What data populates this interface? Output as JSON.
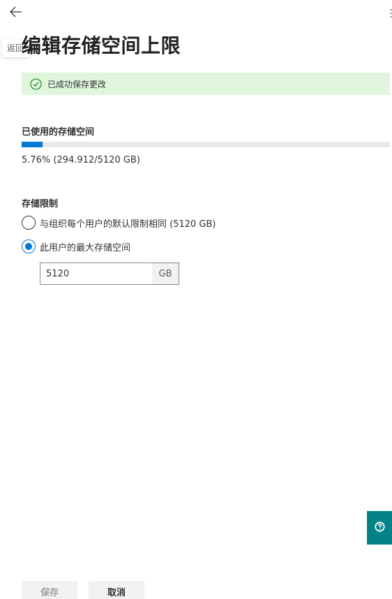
{
  "nav": {
    "back_tooltip": "返回"
  },
  "header": {
    "title": "编辑存储空间上限"
  },
  "notification": {
    "message": "已成功保存更改"
  },
  "usage": {
    "label": "已使用的存储空间",
    "percent": 5.76,
    "text": "5.76% (294.912/5120 GB)"
  },
  "limit": {
    "label": "存储限制",
    "options": [
      {
        "label": "与组织每个用户的默认限制相同 (5120 GB)",
        "selected": false
      },
      {
        "label": "此用户的最大存储空间",
        "selected": true
      }
    ],
    "input_value": "5120",
    "unit": "GB"
  },
  "footer": {
    "save_label": "保存",
    "cancel_label": "取消"
  },
  "colors": {
    "accent": "#0078d4",
    "success_bg": "#dff6dd",
    "help_bg": "#038387"
  },
  "icons": {
    "back": "arrow-left-icon",
    "success": "checkmark-circle-icon",
    "help": "question-circle-icon",
    "more": "more-vertical-icon"
  }
}
